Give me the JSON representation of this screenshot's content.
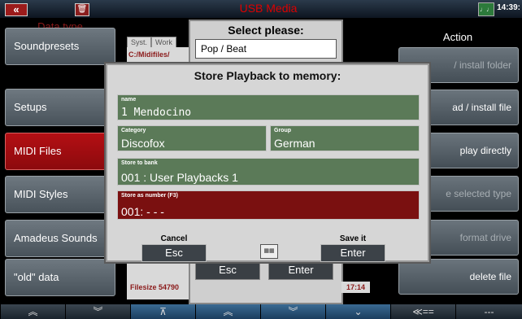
{
  "topbar": {
    "back_icon": "«",
    "trash_icon": "🗑",
    "title": "USB Media",
    "clock": "14:39:",
    "tempo_icon": "tempo-icon"
  },
  "left": {
    "header": "Data type",
    "items": [
      {
        "label": "Soundpresets"
      },
      {
        "label": "Setups"
      },
      {
        "label": "MIDI Files",
        "active": true
      },
      {
        "label": "MIDI Styles"
      },
      {
        "label": "Amadeus Sounds"
      },
      {
        "label": "\"old\" data"
      }
    ]
  },
  "right": {
    "header": "Action",
    "items": [
      {
        "label": "/ install folder"
      },
      {
        "label": "ad / install file"
      },
      {
        "label": "play directly"
      },
      {
        "label": "e selected type"
      },
      {
        "label": "format drive"
      },
      {
        "label": "delete file"
      }
    ]
  },
  "middle": {
    "tabs": [
      "Syst.",
      "Work"
    ],
    "path": "C:/Midifiles/",
    "filesize": "Filesize 54790"
  },
  "select": {
    "title": "Select please:",
    "items": [
      "Pop / Beat"
    ],
    "esc": "Esc",
    "enter": "Enter",
    "time": "17:14"
  },
  "dialog": {
    "title": "Store Playback to memory:",
    "name_label": "name",
    "name_value": "1 Mendocino",
    "category_label": "Category",
    "category_value": "Discofox",
    "group_label": "Group",
    "group_value": "German",
    "bank_label": "Store to bank",
    "bank_value": "001 : User Playbacks 1",
    "number_label": "Store as number (F3)",
    "number_value": "001: - - -",
    "cancel_label": "Cancel",
    "cancel_btn": "Esc",
    "save_label": "Save it",
    "save_btn": "Enter"
  },
  "bottom": [
    "≫",
    "≫",
    "⊼",
    "≪",
    "≫",
    "⌄",
    "≪==",
    "---"
  ]
}
